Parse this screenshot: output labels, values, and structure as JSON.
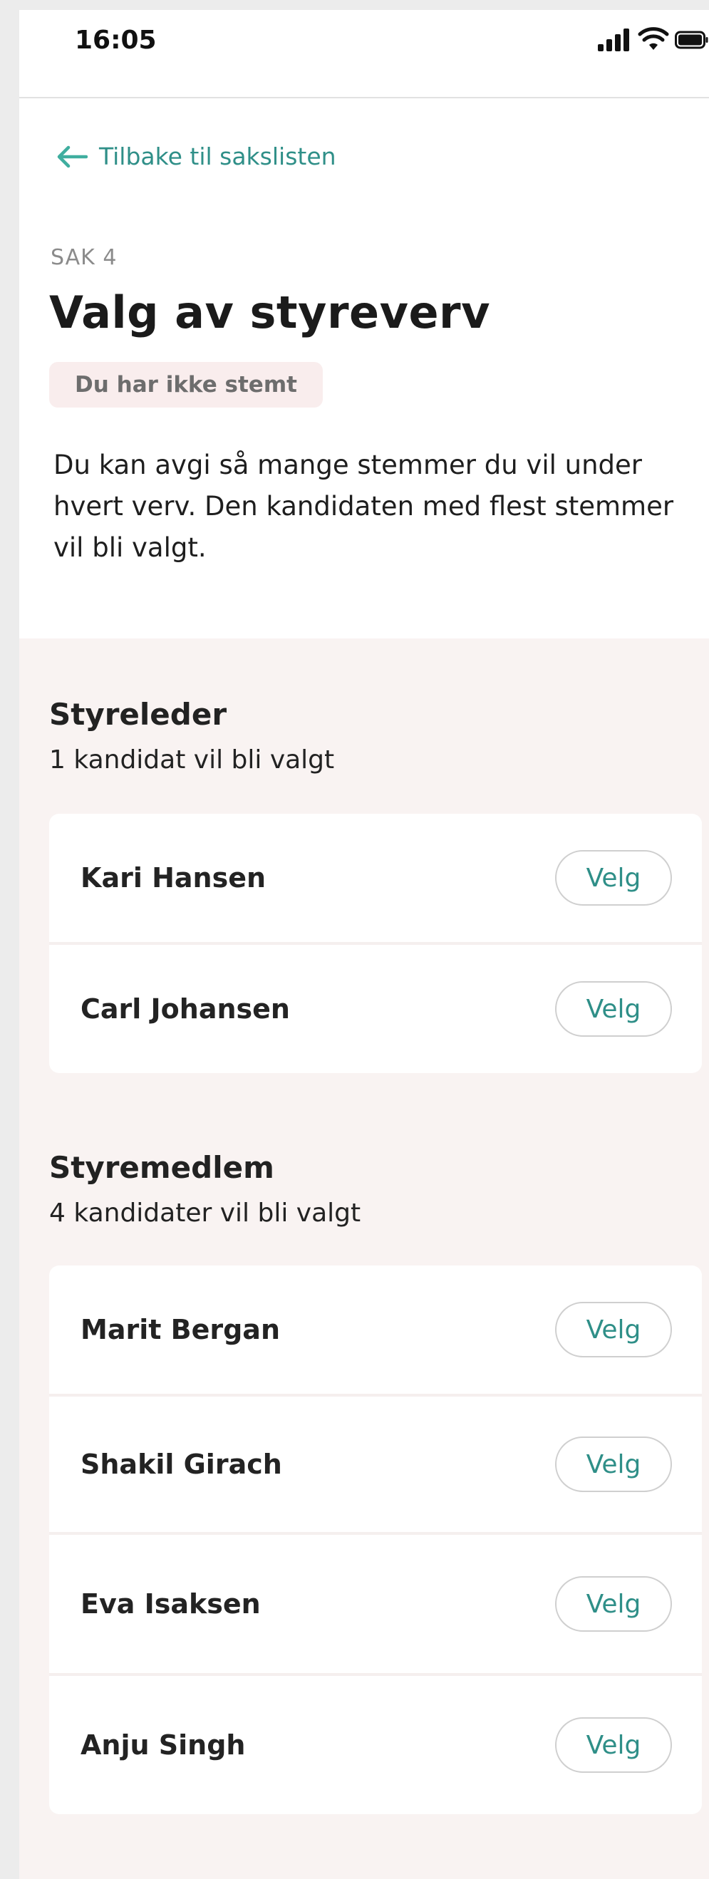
{
  "status_bar": {
    "time": "16:05",
    "icons": [
      "signal-icon",
      "wifi-icon",
      "battery-icon"
    ]
  },
  "back_link": {
    "label": "Tilbake til sakslisten",
    "icon": "arrow-left-icon"
  },
  "sak_label": "SAK 4",
  "title": "Valg av styreverv",
  "status_badge": "Du har ikke stemt",
  "intro": "Du kan avgi så mange stemmer du vil under hvert verv. Den kandidaten med flest stemmer vil bli valgt.",
  "positions": [
    {
      "title": "Styreleder",
      "subtitle": "1 kandidat vil bli valgt",
      "candidates": [
        {
          "name": "Kari Hansen",
          "button": "Velg"
        },
        {
          "name": "Carl Johansen",
          "button": "Velg"
        }
      ]
    },
    {
      "title": "Styremedlem",
      "subtitle": "4 kandidater vil bli valgt",
      "candidates": [
        {
          "name": "Marit Bergan",
          "button": "Velg"
        },
        {
          "name": "Shakil Girach",
          "button": "Velg"
        },
        {
          "name": "Eva Isaksen",
          "button": "Velg"
        },
        {
          "name": "Anju Singh",
          "button": "Velg"
        }
      ]
    }
  ],
  "colors": {
    "accent": "#2f8f88",
    "section_bg": "#f9f3f2",
    "badge_bg": "#f9eded"
  }
}
